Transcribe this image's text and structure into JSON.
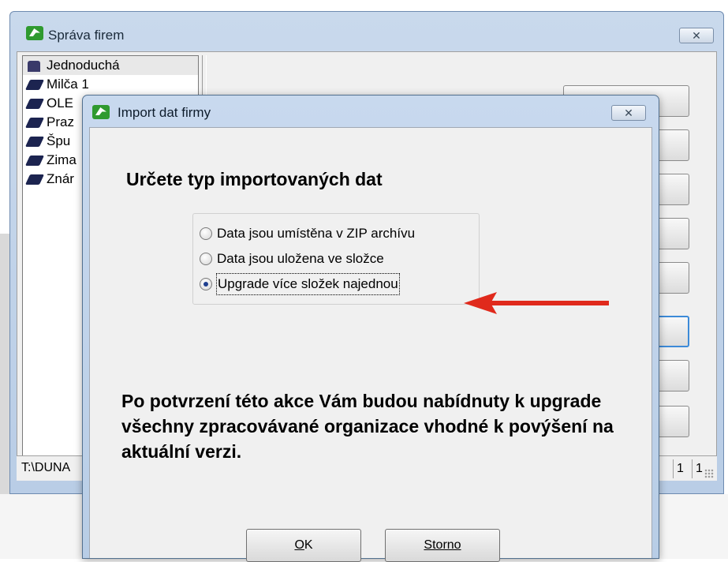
{
  "main_window": {
    "title": "Správa firem",
    "close_label": "✕",
    "companies": [
      {
        "name": "Jednoduchá"
      },
      {
        "name": "Milča 1"
      },
      {
        "name": "OLE"
      },
      {
        "name": "Praz"
      },
      {
        "name": "Špu"
      },
      {
        "name": "Zima"
      },
      {
        "name": "Znár"
      }
    ],
    "status": {
      "path": "T:\\DUNA",
      "cell1": "1",
      "cell2": "1"
    }
  },
  "dialog": {
    "title": "Import dat firmy",
    "close_label": "✕",
    "heading": "Určete typ importovaných dat",
    "options": [
      {
        "label": "Data jsou umístěna v ZIP archívu",
        "checked": false
      },
      {
        "label": "Data jsou uložena ve složce",
        "checked": false
      },
      {
        "label": "Upgrade více složek najednou",
        "checked": true
      }
    ],
    "description": "Po potvrzení této akce Vám budou nabídnuty k upgrade všechny zpracovávané organizace vhodné k povýšení na aktuální verzi.",
    "ok_mnemonic": "O",
    "ok_rest": "K",
    "cancel_label": "Storno"
  },
  "colors": {
    "arrow": "#e02a1c",
    "title_gradient_top": "#c8d9ee",
    "focus_border": "#3c8ad8"
  },
  "icons": {
    "app": "app-logo-icon",
    "company": "book-icon",
    "close": "close-icon"
  }
}
